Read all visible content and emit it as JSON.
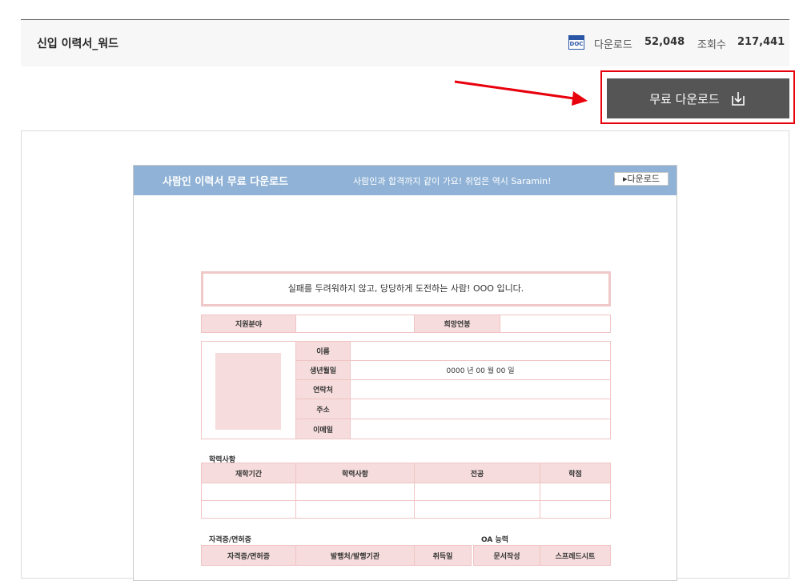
{
  "header": {
    "title": "신입 이력서_워드",
    "file_type_icon": "doc-file-icon",
    "file_type_label": "DOC",
    "downloads_label": "다운로드",
    "downloads_value": "52,048",
    "views_label": "조회수",
    "views_value": "217,441"
  },
  "download_button": {
    "label": "무료 다운로드",
    "icon": "download-icon",
    "highlight_color": "#e8000c"
  },
  "preview": {
    "banner": {
      "title": "사람인 이력서 무료 다운로드",
      "slogan": "사람인과 합격까지 같이 가요! 취업은 역시 Saramin!",
      "button_label": "▸다운로드",
      "color": "#8fb2d6"
    },
    "motto": "실패를 두려워하지 않고, 당당하게 도전하는 사람! OOO 입니다.",
    "apply": {
      "field_label": "지원분야",
      "salary_label": "희망연봉"
    },
    "profile": {
      "name_label": "이름",
      "birth_label": "생년월일",
      "birth_value": "0000 년 00 월 00 일",
      "contact_label": "연락처",
      "address_label": "주소",
      "email_label": "이메일"
    },
    "education": {
      "title": "학력사항",
      "columns": [
        "재학기간",
        "학력사항",
        "전공",
        "학점"
      ]
    },
    "certificates": {
      "title": "자격증/면허증",
      "columns": [
        "자격증/면허증",
        "발행처/발행기관",
        "취득일"
      ]
    },
    "oa": {
      "title": "OA 능력",
      "columns": [
        "문서작성",
        "스프레드시트"
      ]
    }
  }
}
